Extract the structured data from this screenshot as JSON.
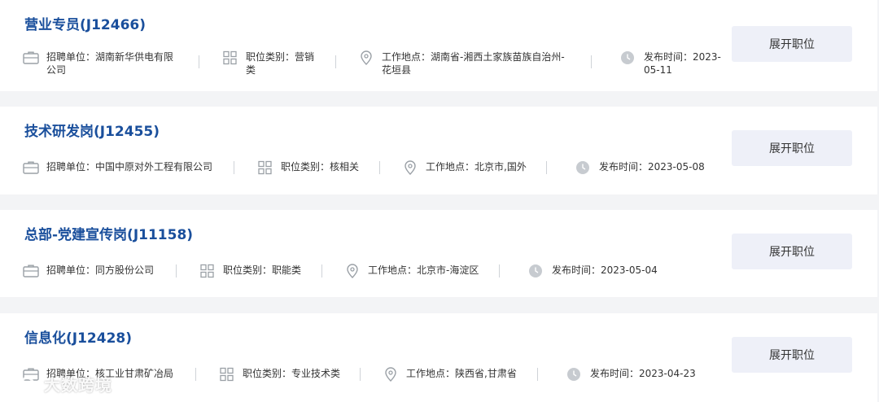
{
  "labels": {
    "company": "招聘单位：",
    "category": "职位类别：",
    "location": "工作地点：",
    "date": "发布时间：",
    "expand": "展开职位"
  },
  "jobs": [
    {
      "title": "营业专员(J12466)",
      "company": "湖南新华供电有限公司",
      "category": "营销类",
      "location": "湖南省-湘西土家族苗族自治州-花垣县",
      "date": "2023-05-11"
    },
    {
      "title": "技术研发岗(J12455)",
      "company": "中国中原对外工程有限公司",
      "category": "核相关",
      "location": "北京市,国外",
      "date": "2023-05-08"
    },
    {
      "title": "总部-党建宣传岗(J11158)",
      "company": "同方股份公司",
      "category": "职能类",
      "location": "北京市-海淀区",
      "date": "2023-05-04"
    },
    {
      "title": "信息化(J12428)",
      "company": "核工业甘肃矿冶局",
      "category": "专业技术类",
      "location": "陕西省,甘肃省",
      "date": "2023-04-23"
    }
  ],
  "watermark": {
    "text": "大数跨境"
  },
  "icons": {
    "company": "briefcase-icon",
    "category": "grid-icon",
    "location": "map-pin-icon",
    "date": "clock-icon"
  },
  "colors": {
    "title": "#1a4f9c",
    "button_bg": "#eef0f8",
    "page_bg": "#f3f4f6"
  }
}
